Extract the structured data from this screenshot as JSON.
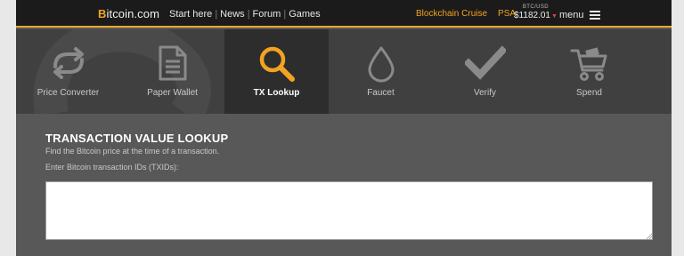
{
  "header": {
    "logo_initial": "B",
    "logo_rest": "itcoin.com",
    "nav": [
      "Start here",
      "News",
      "Forum",
      "Games"
    ],
    "cruise": "Blockchain Cruise",
    "psa": "PSA",
    "price_label": "BTC/USD",
    "price_value": "$1182.01",
    "menu": "menu"
  },
  "tools": [
    {
      "label": "Price Converter",
      "icon": "sync-arrows-icon"
    },
    {
      "label": "Paper Wallet",
      "icon": "document-icon"
    },
    {
      "label": "TX Lookup",
      "icon": "magnifier-icon",
      "active": true
    },
    {
      "label": "Faucet",
      "icon": "drop-icon"
    },
    {
      "label": "Verify",
      "icon": "checkmark-icon"
    },
    {
      "label": "Spend",
      "icon": "shopping-cart-icon"
    }
  ],
  "lookup": {
    "title": "TRANSACTION VALUE LOOKUP",
    "subtitle": "Find the Bitcoin price at the time of a transaction.",
    "field_label": "Enter Bitcoin transaction IDs (TXIDs):",
    "textarea_value": ""
  },
  "colors": {
    "accent": "#f3a321",
    "topbar": "#1b1b1b",
    "tools_bg": "#404040",
    "active_tool_bg": "#2d2d2d",
    "content_bg": "#585858"
  }
}
